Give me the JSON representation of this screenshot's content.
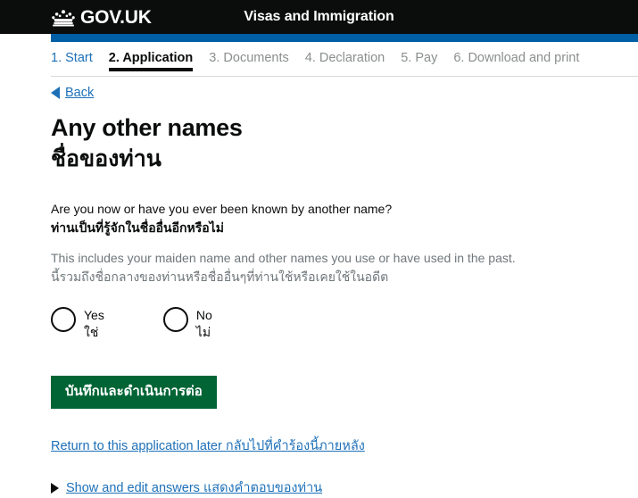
{
  "header": {
    "logo_text": "GOV.UK",
    "logo_icon": "crown-icon",
    "service_name": "Visas and Immigration",
    "background_color": "#0b0c0c",
    "progress_bar_color": "#005ea5"
  },
  "steps": [
    {
      "label": "1. Start",
      "state": "link"
    },
    {
      "label": "2. Application",
      "state": "current"
    },
    {
      "label": "3. Documents",
      "state": "muted"
    },
    {
      "label": "4. Declaration",
      "state": "muted"
    },
    {
      "label": "5. Pay",
      "state": "muted"
    },
    {
      "label": "6. Download and print",
      "state": "muted"
    }
  ],
  "back": {
    "label": "Back",
    "icon": "back-arrow-icon"
  },
  "page": {
    "title_en": "Any other names",
    "title_th": "ชื่อของท่าน"
  },
  "question": {
    "text_en": "Are you now or have you ever been known by another name?",
    "text_th": "ท่านเป็นที่รู้จักในชื่ออื่นอีกหรือไม่",
    "hint_en": "This includes your maiden name and other names you use or have used in the past.",
    "hint_th": "นี้รวมถึงชื่อกลางของท่านหรือชื่ออื่นๆที่ท่านใช้หรือเคยใช้ในอดีต"
  },
  "radios": [
    {
      "label_en": "Yes",
      "label_th": "ใช่",
      "selected": false
    },
    {
      "label_en": "No",
      "label_th": "ไม่",
      "selected": false
    }
  ],
  "submit": {
    "label": "บันทึกและดำเนินการต่อ",
    "color": "#006435"
  },
  "footer_links": {
    "return_later": "Return to this application later กลับไปที่คำร้องนี้ภายหลัง",
    "show_answers": "Show and edit answers แสดงคำตอบของท่าน",
    "show_answers_icon": "disclosure-triangle-icon"
  }
}
